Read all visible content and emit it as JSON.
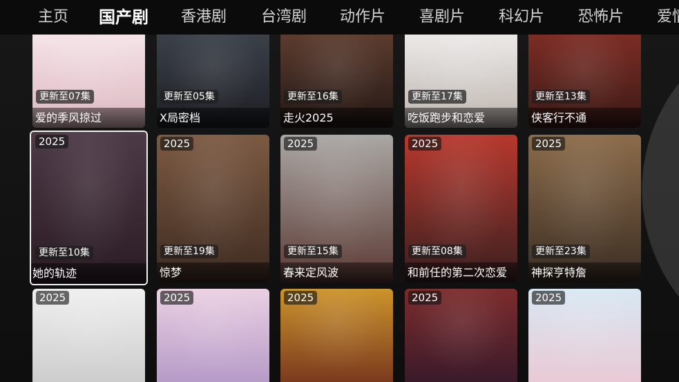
{
  "nav": {
    "tabs": [
      {
        "label": "主页",
        "selected": false
      },
      {
        "label": "国产剧",
        "selected": true
      },
      {
        "label": "香港剧",
        "selected": false
      },
      {
        "label": "台湾剧",
        "selected": false
      },
      {
        "label": "动作片",
        "selected": false
      },
      {
        "label": "喜剧片",
        "selected": false
      },
      {
        "label": "科幻片",
        "selected": false
      },
      {
        "label": "恐怖片",
        "selected": false
      },
      {
        "label": "爱情片",
        "selected": false
      }
    ]
  },
  "grid": {
    "focused": "她的轨迹",
    "rows": [
      [
        {
          "update": "更新至07集",
          "title": "爱的季风掠过",
          "colors": [
            "#f4e4e8",
            "#dcb6be"
          ]
        },
        {
          "update": "更新至05集",
          "title": "X局密档",
          "colors": [
            "#3b4049",
            "#1c1e23"
          ]
        },
        {
          "update": "更新至16集",
          "title": "走火2025",
          "colors": [
            "#5c3c2e",
            "#221714"
          ]
        },
        {
          "update": "更新至17集",
          "title": "吃饭跑步和恋爱",
          "colors": [
            "#ebe9e7",
            "#bdb4ae"
          ]
        },
        {
          "update": "更新至13集",
          "title": "侠客行不通",
          "colors": [
            "#7c2c24",
            "#3a1a15"
          ]
        }
      ],
      [
        {
          "year": "2025",
          "update": "更新至10集",
          "title": "她的轨迹",
          "colors": [
            "#4d3a47",
            "#2a1b23"
          ]
        },
        {
          "year": "2025",
          "update": "更新至19集",
          "title": "惊梦",
          "colors": [
            "#7c5a42",
            "#3d2a20"
          ]
        },
        {
          "year": "2025",
          "update": "更新至15集",
          "title": "春来定风波",
          "colors": [
            "#aaa7a4",
            "#5c3a34"
          ]
        },
        {
          "year": "2025",
          "update": "更新至08集",
          "title": "和前任的第二次恋爱",
          "colors": [
            "#b8382d",
            "#381f1f"
          ]
        },
        {
          "year": "2025",
          "update": "更新至23集",
          "title": "神探亨特詹",
          "colors": [
            "#8c6c4a",
            "#3a2d23"
          ]
        }
      ],
      [
        {
          "year": "2025",
          "colors": [
            "#efefef",
            "#cdcdcd"
          ]
        },
        {
          "year": "2025",
          "colors": [
            "#ead0e2",
            "#b69bc8"
          ]
        },
        {
          "year": "2025",
          "colors": [
            "#cc942c",
            "#7a3a1e"
          ]
        },
        {
          "year": "2025",
          "colors": [
            "#7c2c2c",
            "#3a1a2a"
          ]
        },
        {
          "year": "2025",
          "colors": [
            "#d8e8f3",
            "#e9c9d5"
          ]
        }
      ]
    ]
  }
}
